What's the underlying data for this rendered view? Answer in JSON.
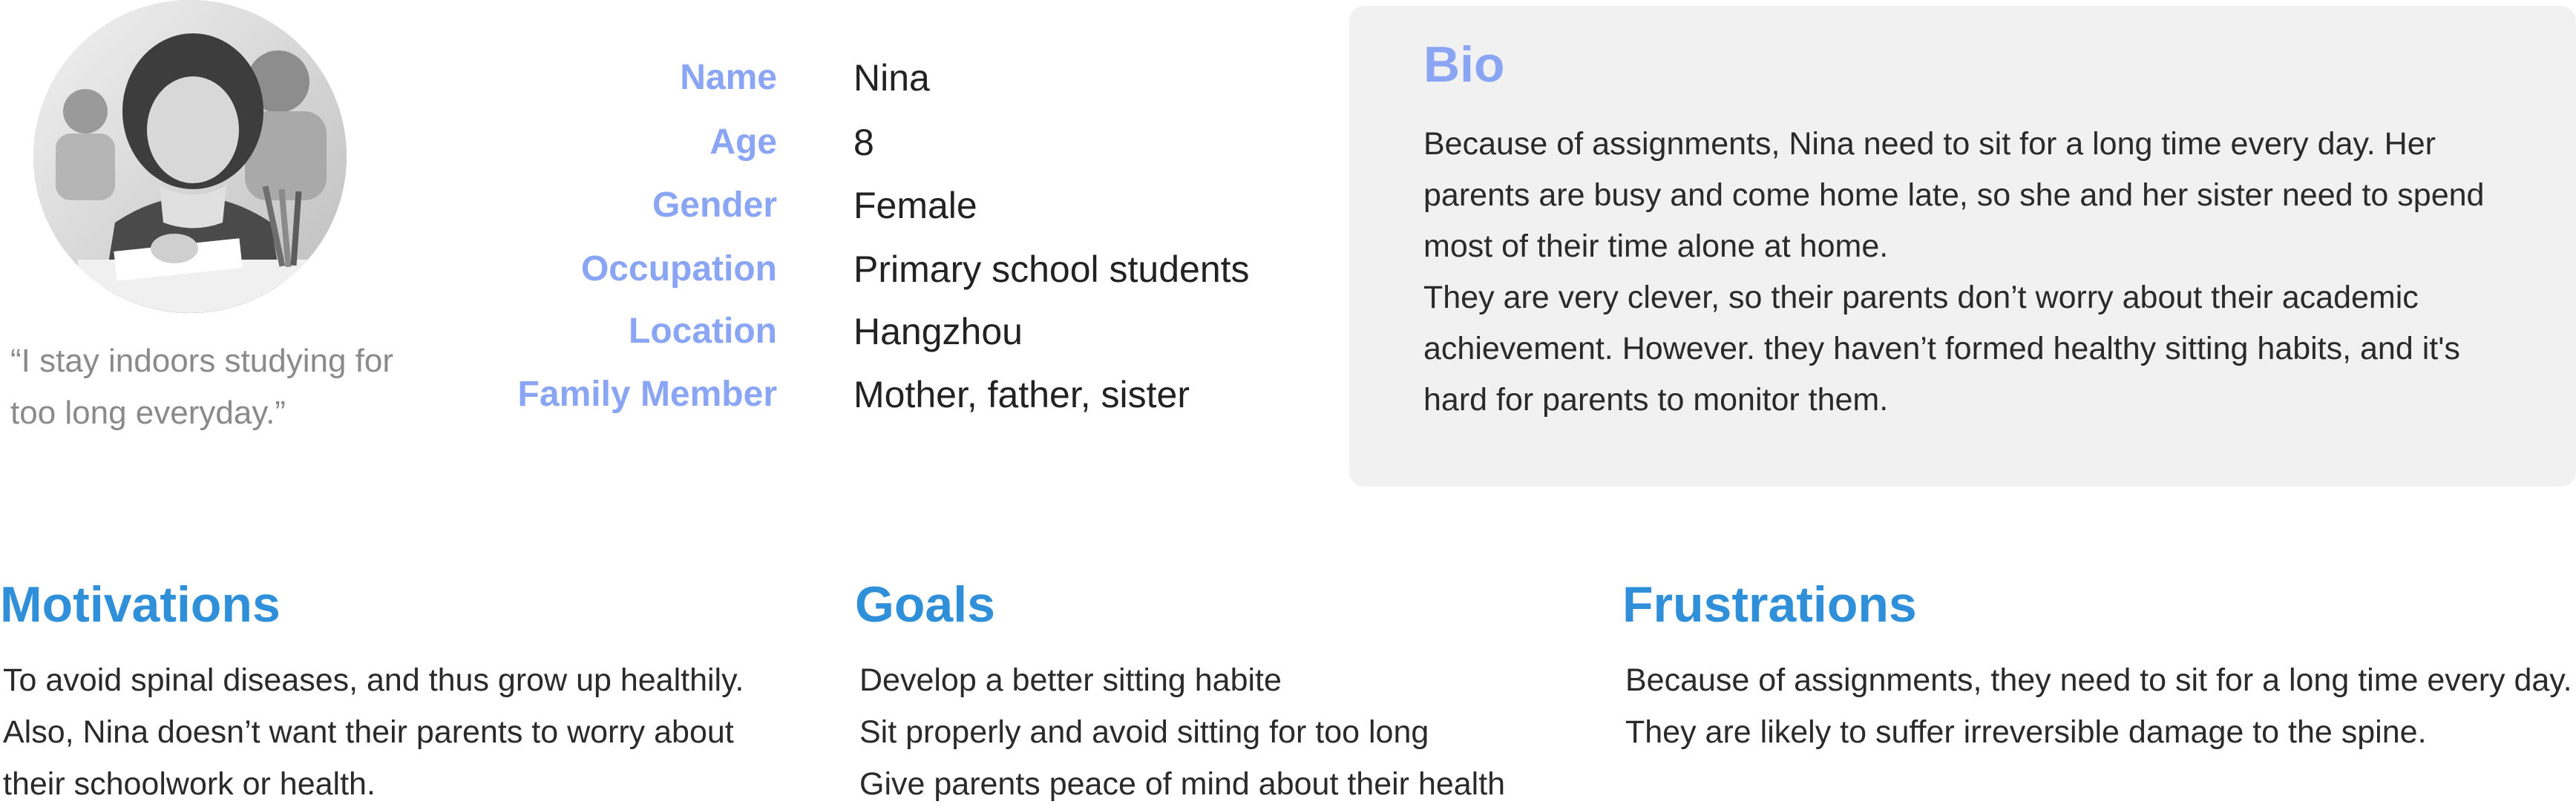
{
  "persona": {
    "avatar_description_icon": "child-studying-photo",
    "quote_line1": "“I stay indoors studying for",
    "quote_line2": "too long everyday.”"
  },
  "profile": {
    "rows": [
      {
        "label": "Name",
        "value": "Nina"
      },
      {
        "label": "Age",
        "value": "8"
      },
      {
        "label": "Gender",
        "value": "Female"
      },
      {
        "label": "Occupation",
        "value": "Primary school students"
      },
      {
        "label": "Location",
        "value": "Hangzhou"
      },
      {
        "label": "Family Member",
        "value": "Mother, father, sister"
      }
    ]
  },
  "bio": {
    "title": "Bio",
    "lines": [
      "Because of assignments, Nina need to sit for a long time every day. Her",
      "parents are busy and come home late, so she and her sister need to spend",
      "most of their time alone at home.",
      "They are very clever, so their parents don’t worry about their academic",
      "achievement. However. they haven’t formed healthy sitting habits, and it's",
      "hard for parents to monitor them."
    ]
  },
  "motivations": {
    "title": "Motivations",
    "lines": [
      "To avoid spinal diseases, and thus grow up healthily.",
      "Also, Nina doesn’t want their parents to worry about",
      "their schoolwork or health."
    ]
  },
  "goals": {
    "title": "Goals",
    "lines": [
      "Develop a better sitting habite",
      "Sit properly and avoid sitting for too long",
      "Give parents peace of mind about their health"
    ]
  },
  "frustrations": {
    "title": "Frustrations",
    "lines": [
      "Because of assignments, they need to sit for a long time every day.",
      "They are likely to suffer irreversible damage to the spine."
    ]
  },
  "colors": {
    "label_blue": "#8ba5f5",
    "section_blue": "#2f8fd9",
    "card_bg": "#f1f1f1",
    "quote_gray": "#8a8a8a"
  }
}
